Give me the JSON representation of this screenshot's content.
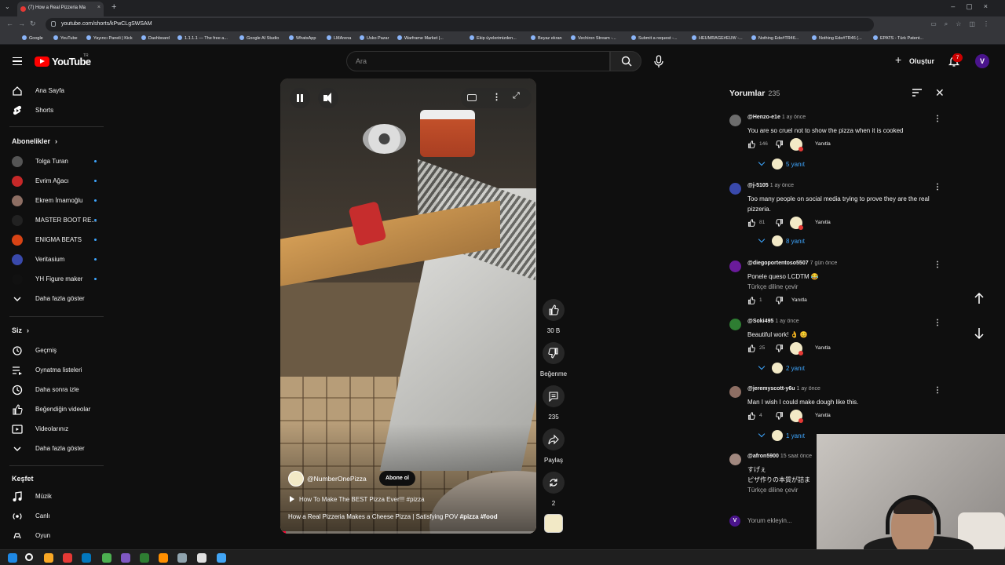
{
  "browser": {
    "tab_title": "(7) How a Real Pizzeria Ma",
    "url": "youtube.com/shorts/kPwCLgSWSAM",
    "bookmarks": [
      "Google",
      "YouTube",
      "Yayıncı Paneli | Kick",
      "Dashboard",
      "1.1.1.1 — The free a...",
      "Google AI Studio",
      "WhatsApp",
      "LMArena",
      "Usko Pazar",
      "Warframe Market |...",
      "Ekip üyelerimizden...",
      "Beyaz ekran",
      "Vechiron Stream -...",
      "Submit a request -...",
      "HEUMRAGE#EUW -...",
      "Nothing Ede#TR46...",
      "Nothing Ede#TR46 (...",
      "EPATS - Türk Patent..."
    ]
  },
  "header": {
    "logo_text": "YouTube",
    "country": "TR",
    "search_placeholder": "Ara",
    "create_label": "Oluştur",
    "notification_count": "7",
    "avatar_letter": "V"
  },
  "sidebar": {
    "main": [
      {
        "label": "Ana Sayfa",
        "icon": "home-icon"
      },
      {
        "label": "Shorts",
        "icon": "shorts-icon"
      }
    ],
    "subs_heading": "Abonelikler",
    "subs": [
      {
        "label": "Tolga Turan",
        "color": "#555555"
      },
      {
        "label": "Evrim Ağacı",
        "color": "#c62828"
      },
      {
        "label": "Ekrem İmamoğlu",
        "color": "#8d6e63"
      },
      {
        "label": "MASTER BOOT RE...",
        "color": "#222222"
      },
      {
        "label": "ENIGMA BEATS",
        "color": "#d84315"
      },
      {
        "label": "Veritasium",
        "color": "#3949ab"
      },
      {
        "label": "YH Figure maker",
        "color": "#111111"
      }
    ],
    "subs_more": "Daha fazla göster",
    "you_heading": "Siz",
    "you": [
      {
        "label": "Geçmiş",
        "icon": "history-icon"
      },
      {
        "label": "Oynatma listeleri",
        "icon": "playlist-icon"
      },
      {
        "label": "Daha sonra izle",
        "icon": "clock-icon"
      },
      {
        "label": "Beğendiğin videolar",
        "icon": "like-icon"
      },
      {
        "label": "Videolarınız",
        "icon": "video-icon"
      }
    ],
    "you_more": "Daha fazla göster",
    "explore_heading": "Keşfet",
    "explore": [
      {
        "label": "Müzik",
        "icon": "music-icon"
      },
      {
        "label": "Canlı",
        "icon": "live-icon"
      },
      {
        "label": "Oyun",
        "icon": "game-icon"
      }
    ]
  },
  "video": {
    "channel": "@NumberOnePizza",
    "subscribe_label": "Abone ol",
    "related": "How To Make The BEST Pizza Ever!!! #pizza",
    "title_plain": "How a Real Pizzeria Makes a Cheese Pizza | Satisfying POV ",
    "title_tags": "#pizza #food",
    "progress": 0.02
  },
  "actions": {
    "likes": "30 B",
    "dislike_label": "Beğenme",
    "comments": "235",
    "share_label": "Paylaş",
    "remix_count": "2"
  },
  "comments_panel": {
    "title": "Yorumlar",
    "count": "235",
    "reply_label": "Yanıtla",
    "translate_label": "Türkçe diline çevir",
    "add_placeholder": "Yorum ekleyin...",
    "comments": [
      {
        "author": "@Henzo-e1e",
        "time": "1 ay önce",
        "text": "You are so cruel not to show the pizza when it is cooked",
        "likes": "146",
        "replies": "5 yanıt"
      },
      {
        "author": "@j-5105",
        "time": "1 ay önce",
        "text": "Too many people on social media trying to prove they are the real pizzeria.",
        "likes": "81",
        "replies": "8 yanıt"
      },
      {
        "author": "@diegoportentoso5507",
        "time": "7 gün önce",
        "text": "Ponele queso LCDTM 😂",
        "likes": "1",
        "replies": ""
      },
      {
        "author": "@Soki495",
        "time": "1 ay önce",
        "text": "Beautiful work! 👌 😊",
        "likes": "25",
        "replies": "2 yanıt"
      },
      {
        "author": "@jeremyscott-y6u",
        "time": "1 ay önce",
        "text": "Man I wish I could make dough like this.",
        "likes": "4",
        "replies": "1 yanıt"
      },
      {
        "author": "@afron5900",
        "time": "15 saat önce",
        "text": "すげぇ\nピザ作りの本質が詰ま",
        "likes": "",
        "replies": ""
      }
    ]
  },
  "colors": {
    "brand_red": "#ff0000",
    "link_blue": "#3ea6ff",
    "bg": "#0f0f0f"
  }
}
